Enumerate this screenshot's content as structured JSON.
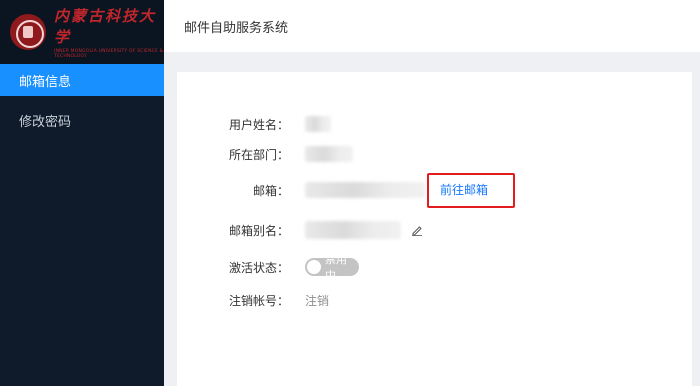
{
  "logo": {
    "name_cn": "内蒙古科技大学",
    "name_en": "INNER MONGOLIA UNIVERSITY OF SCIENCE & TECHNOLOGY"
  },
  "sidebar": {
    "items": [
      {
        "label": "邮箱信息",
        "active": true
      },
      {
        "label": "修改密码",
        "active": false
      }
    ]
  },
  "header": {
    "title": "邮件自助服务系统"
  },
  "info": {
    "name_label": "用户姓名：",
    "dept_label": "所在部门：",
    "email_label": "邮箱：",
    "goto_label": "前往邮箱",
    "alias_label": "邮箱别名：",
    "status_label": "激活状态：",
    "status_toggle": "禁用中",
    "cancel_label": "注销帐号：",
    "cancel_link": "注销"
  },
  "colors": {
    "accent": "#1890ff",
    "sidebar_bg": "#0f1b2a",
    "highlight_box": "#e31d1d"
  }
}
